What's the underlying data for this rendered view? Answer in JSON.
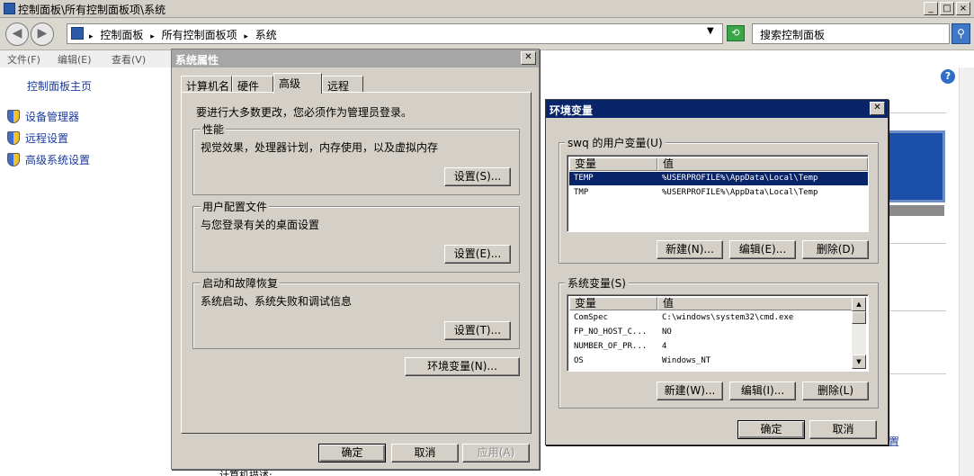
{
  "window": {
    "title": "控制面板\\所有控制面板项\\系统",
    "min": "_",
    "max": "□",
    "close": "×"
  },
  "address": {
    "crumbs": [
      "控制面板",
      "所有控制面板项",
      "系统"
    ],
    "search_placeholder": "搜索控制面板"
  },
  "menu": [
    "文件(F)",
    "编辑(E)",
    "查看(V)"
  ],
  "sidebar": {
    "home": "控制面板主页",
    "items": [
      "设备管理器",
      "远程设置",
      "高级系统设置"
    ]
  },
  "cp_right": {
    "settings_link": "置",
    "bottom_text": "计算机描述:",
    "help": "?"
  },
  "sysprop": {
    "title": "系统属性",
    "tabs": [
      "计算机名",
      "硬件",
      "高级",
      "远程"
    ],
    "active_tab": "高级",
    "admin_note": "要进行大多数更改，您必须作为管理员登录。",
    "groups": [
      {
        "label": "性能",
        "desc": "视觉效果，处理器计划，内存使用，以及虚拟内存",
        "button": "设置(S)..."
      },
      {
        "label": "用户配置文件",
        "desc": "与您登录有关的桌面设置",
        "button": "设置(E)..."
      },
      {
        "label": "启动和故障恢复",
        "desc": "系统启动、系统失败和调试信息",
        "button": "设置(T)..."
      }
    ],
    "env_button": "环境变量(N)...",
    "ok": "确定",
    "cancel": "取消",
    "apply": "应用(A)"
  },
  "envvar": {
    "title": "环境变量",
    "user_group_label": "swq 的用户变量(U)",
    "col_var": "变量",
    "col_val": "值",
    "user_vars": [
      {
        "name": "TEMP",
        "value": "%USERPROFILE%\\AppData\\Local\\Temp",
        "selected": true
      },
      {
        "name": "TMP",
        "value": "%USERPROFILE%\\AppData\\Local\\Temp",
        "selected": false
      }
    ],
    "user_buttons": [
      "新建(N)...",
      "编辑(E)...",
      "删除(D)"
    ],
    "sys_group_label": "系统变量(S)",
    "sys_vars": [
      {
        "name": "ComSpec",
        "value": "C:\\windows\\system32\\cmd.exe"
      },
      {
        "name": "FP_NO_HOST_C...",
        "value": "NO"
      },
      {
        "name": "NUMBER_OF_PR...",
        "value": "4"
      },
      {
        "name": "OS",
        "value": "Windows_NT"
      }
    ],
    "sys_buttons": [
      "新建(W)...",
      "编辑(I)...",
      "删除(L)"
    ],
    "ok": "确定",
    "cancel": "取消"
  }
}
